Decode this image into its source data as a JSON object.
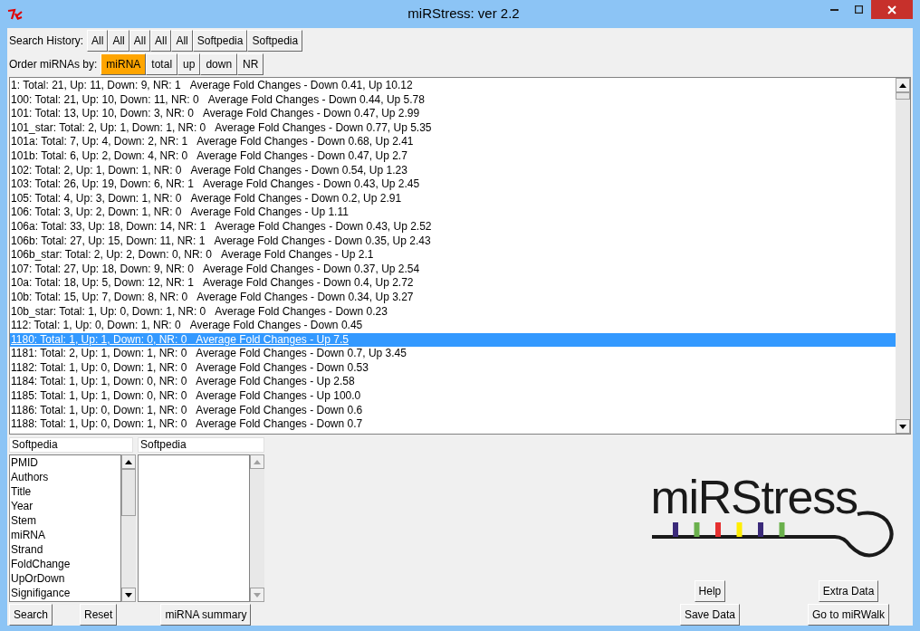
{
  "window": {
    "title": "miRStress: ver 2.2"
  },
  "search_history": {
    "label": "Search History:",
    "buttons": [
      "All",
      "All",
      "All",
      "All",
      "All",
      "Softpedia",
      "Softpedia"
    ]
  },
  "order_by": {
    "label": "Order miRNAs by:",
    "options": [
      {
        "label": "miRNA",
        "selected": true
      },
      {
        "label": "total",
        "selected": false
      },
      {
        "label": "up",
        "selected": false
      },
      {
        "label": "down",
        "selected": false
      },
      {
        "label": "NR",
        "selected": false
      }
    ]
  },
  "results": [
    {
      "counts": "1: Total: 21, Up: 11, Down: 9, NR: 1",
      "fold_changes": "Average Fold Changes - Down 0.41, Up 10.12",
      "selected": false
    },
    {
      "counts": "100: Total: 21, Up: 10, Down: 11, NR: 0",
      "fold_changes": "Average Fold Changes - Down 0.44, Up 5.78",
      "selected": false
    },
    {
      "counts": "101: Total: 13, Up: 10, Down: 3, NR: 0",
      "fold_changes": "Average Fold Changes - Down 0.47, Up 2.99",
      "selected": false
    },
    {
      "counts": "101_star: Total: 2, Up: 1, Down: 1, NR: 0",
      "fold_changes": "Average Fold Changes - Down 0.77, Up 5.35",
      "selected": false
    },
    {
      "counts": "101a: Total: 7, Up: 4, Down: 2, NR: 1",
      "fold_changes": "Average Fold Changes - Down 0.68, Up 2.41",
      "selected": false
    },
    {
      "counts": "101b: Total: 6, Up: 2, Down: 4, NR: 0",
      "fold_changes": "Average Fold Changes - Down 0.47, Up 2.7",
      "selected": false
    },
    {
      "counts": "102: Total: 2, Up: 1, Down: 1, NR: 0",
      "fold_changes": "Average Fold Changes - Down 0.54, Up 1.23",
      "selected": false
    },
    {
      "counts": "103: Total: 26, Up: 19, Down: 6, NR: 1",
      "fold_changes": "Average Fold Changes - Down 0.43, Up 2.45",
      "selected": false
    },
    {
      "counts": "105: Total: 4, Up: 3, Down: 1, NR: 0",
      "fold_changes": "Average Fold Changes - Down 0.2, Up 2.91",
      "selected": false
    },
    {
      "counts": "106: Total: 3, Up: 2, Down: 1, NR: 0",
      "fold_changes": "Average Fold Changes - Up 1.11",
      "selected": false
    },
    {
      "counts": "106a: Total: 33, Up: 18, Down: 14, NR: 1",
      "fold_changes": "Average Fold Changes - Down 0.43, Up 2.52",
      "selected": false
    },
    {
      "counts": "106b: Total: 27, Up: 15, Down: 11, NR: 1",
      "fold_changes": "Average Fold Changes - Down 0.35, Up 2.43",
      "selected": false
    },
    {
      "counts": "106b_star: Total: 2, Up: 2, Down: 0, NR: 0",
      "fold_changes": "Average Fold Changes - Up 2.1",
      "selected": false
    },
    {
      "counts": "107: Total: 27, Up: 18, Down: 9, NR: 0",
      "fold_changes": "Average Fold Changes - Down 0.37, Up 2.54",
      "selected": false
    },
    {
      "counts": "10a: Total: 18, Up: 5, Down: 12, NR: 1",
      "fold_changes": "Average Fold Changes - Down 0.4, Up 2.72",
      "selected": false
    },
    {
      "counts": "10b: Total: 15, Up: 7, Down: 8, NR: 0",
      "fold_changes": "Average Fold Changes - Down 0.34, Up 3.27",
      "selected": false
    },
    {
      "counts": "10b_star: Total: 1, Up: 0, Down: 1, NR: 0",
      "fold_changes": "Average Fold Changes - Down 0.23",
      "selected": false
    },
    {
      "counts": "112: Total: 1, Up: 0, Down: 1, NR: 0",
      "fold_changes": "Average Fold Changes - Down 0.45",
      "selected": false
    },
    {
      "counts": "1180: Total: 1, Up: 1, Down: 0, NR: 0",
      "fold_changes": "Average Fold Changes - Up 7.5",
      "selected": true
    },
    {
      "counts": "1181: Total: 2, Up: 1, Down: 1, NR: 0",
      "fold_changes": "Average Fold Changes - Down 0.7, Up 3.45",
      "selected": false
    },
    {
      "counts": "1182: Total: 1, Up: 0, Down: 1, NR: 0",
      "fold_changes": "Average Fold Changes - Down 0.53",
      "selected": false
    },
    {
      "counts": "1184: Total: 1, Up: 1, Down: 0, NR: 0",
      "fold_changes": "Average Fold Changes - Up 2.58",
      "selected": false
    },
    {
      "counts": "1185: Total: 1, Up: 1, Down: 0, NR: 0",
      "fold_changes": "Average Fold Changes - Up 100.0",
      "selected": false
    },
    {
      "counts": "1186: Total: 1, Up: 0, Down: 1, NR: 0",
      "fold_changes": "Average Fold Changes - Down 0.6",
      "selected": false
    },
    {
      "counts": "1188: Total: 1, Up: 0, Down: 1, NR: 0",
      "fold_changes": "Average Fold Changes - Down 0.7",
      "selected": false
    }
  ],
  "field_list": {
    "value": "Softpedia",
    "items": [
      "PMID",
      "Authors",
      "Title",
      "Year",
      "Stem",
      "miRNA",
      "Strand",
      "FoldChange",
      "UpOrDown",
      "Signifigance"
    ]
  },
  "value_list": {
    "value": "Softpedia"
  },
  "left_buttons": [
    "Search",
    "Reset",
    "miRNA summary"
  ],
  "logo": {
    "text": "miRStress"
  },
  "right_buttons": [
    "Help",
    "Extra Data",
    "Save Data",
    "Go to miRWalk"
  ]
}
